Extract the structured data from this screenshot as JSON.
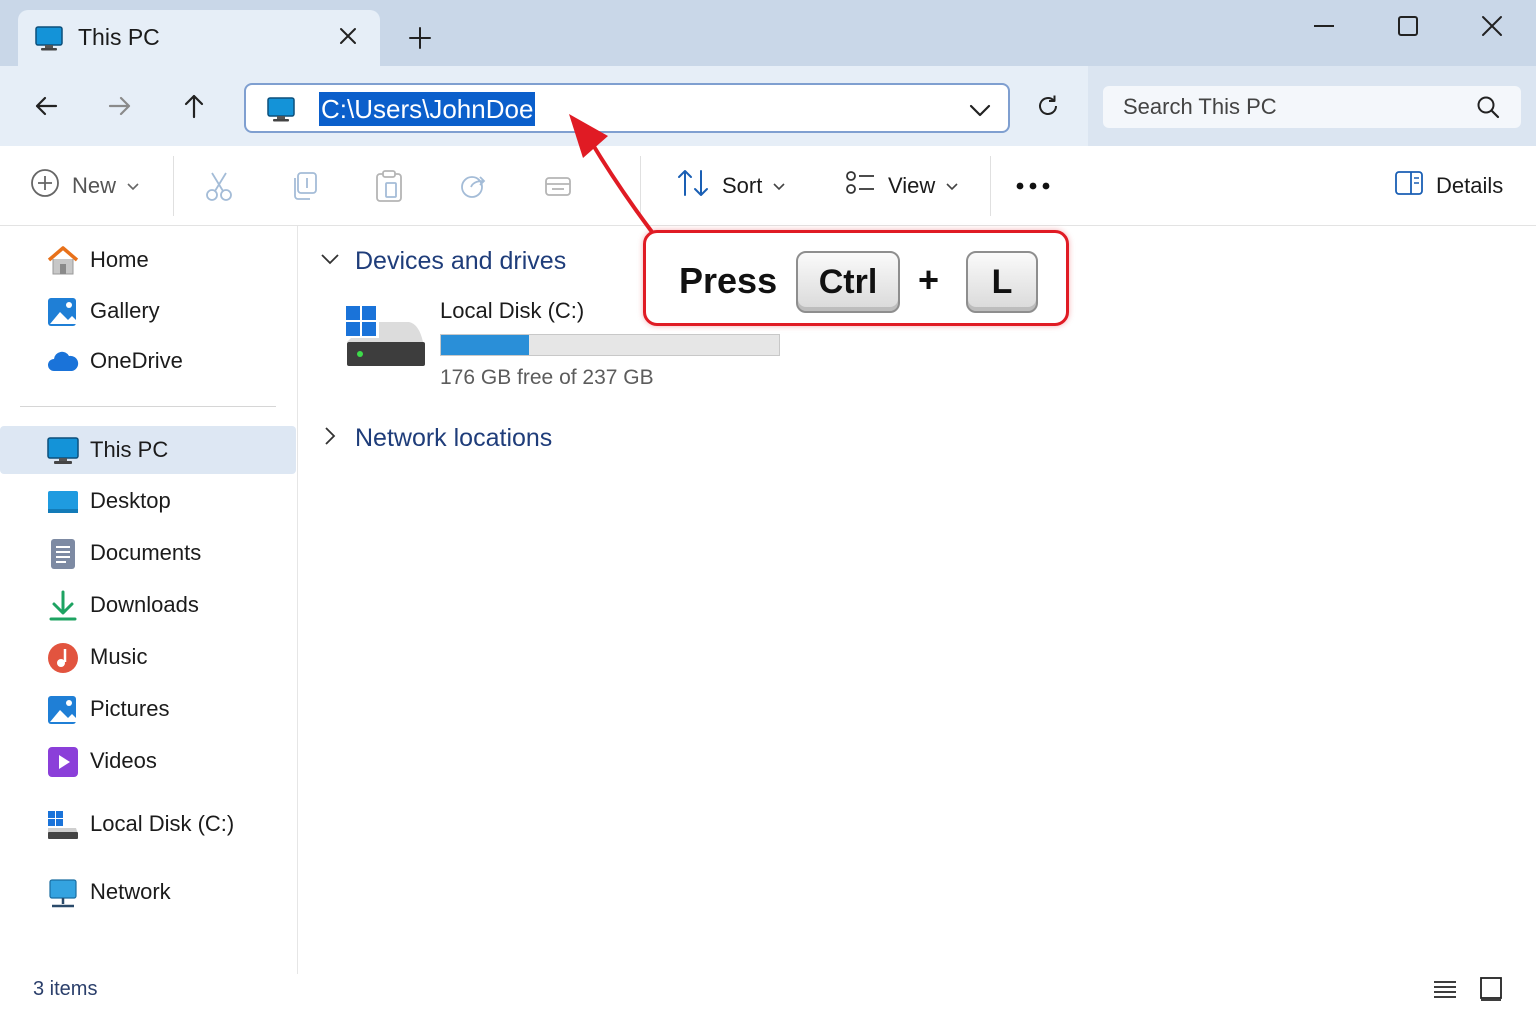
{
  "window": {
    "tab_title": "This PC",
    "icons": {
      "tab": "computer-icon",
      "close": "close-icon",
      "new_tab": "plus-icon",
      "minimize": "minimize-icon",
      "maximize": "maximize-icon",
      "close_window": "close-icon"
    }
  },
  "addressbar": {
    "path": "C:\\Users\\JohnDoe",
    "path_selected": true,
    "search_placeholder": "Search This PC",
    "icons": {
      "back": "arrow-left-icon",
      "forward": "arrow-right-icon",
      "up": "arrow-up-icon",
      "location": "computer-icon",
      "dropdown": "chevron-down-icon",
      "refresh": "refresh-icon",
      "search": "search-icon"
    }
  },
  "toolbar": {
    "new_label": "New",
    "sort_label": "Sort",
    "view_label": "View",
    "details_label": "Details",
    "icons": {
      "new": "plus-circle-icon",
      "cut": "scissors-icon",
      "copy": "copy-icon",
      "paste": "clipboard-icon",
      "share": "share-icon",
      "rename": "rename-icon",
      "sort": "sort-arrows-icon",
      "view": "view-list-icon",
      "more": "ellipsis-icon",
      "details": "details-pane-icon"
    }
  },
  "sidebar": {
    "quick": [
      {
        "label": "Home",
        "icon": "home-icon"
      },
      {
        "label": "Gallery",
        "icon": "gallery-icon"
      },
      {
        "label": "OneDrive",
        "icon": "cloud-icon"
      }
    ],
    "locations": [
      {
        "label": "This PC",
        "icon": "computer-icon",
        "selected": true
      },
      {
        "label": "Desktop",
        "icon": "desktop-icon"
      },
      {
        "label": "Documents",
        "icon": "document-icon"
      },
      {
        "label": "Downloads",
        "icon": "download-icon"
      },
      {
        "label": "Music",
        "icon": "music-icon"
      },
      {
        "label": "Pictures",
        "icon": "picture-icon"
      },
      {
        "label": "Videos",
        "icon": "video-icon"
      }
    ],
    "drives": [
      {
        "label": "Local Disk (C:)",
        "icon": "drive-icon"
      }
    ],
    "network": [
      {
        "label": "Network",
        "icon": "network-icon"
      }
    ]
  },
  "content": {
    "devices_header": "Devices and drives",
    "network_header": "Network locations",
    "drives": [
      {
        "name": "Local Disk (C:)",
        "free_text": "176 GB free of 237 GB",
        "used_fraction": 0.26,
        "icon": "windows-drive-icon"
      }
    ]
  },
  "status": {
    "item_count": "3 items",
    "icons": {
      "details_view": "details-view-icon",
      "tiles_view": "tiles-view-icon"
    }
  },
  "callout": {
    "press_label": "Press",
    "key1": "Ctrl",
    "plus": "+",
    "key2": "L",
    "color": "#e01b24"
  },
  "colors": {
    "titlebar": "#c9d7e8",
    "accent": "#0b5fcb",
    "drive_fill": "#2a8fd8",
    "header_text": "#1f3d7a"
  }
}
